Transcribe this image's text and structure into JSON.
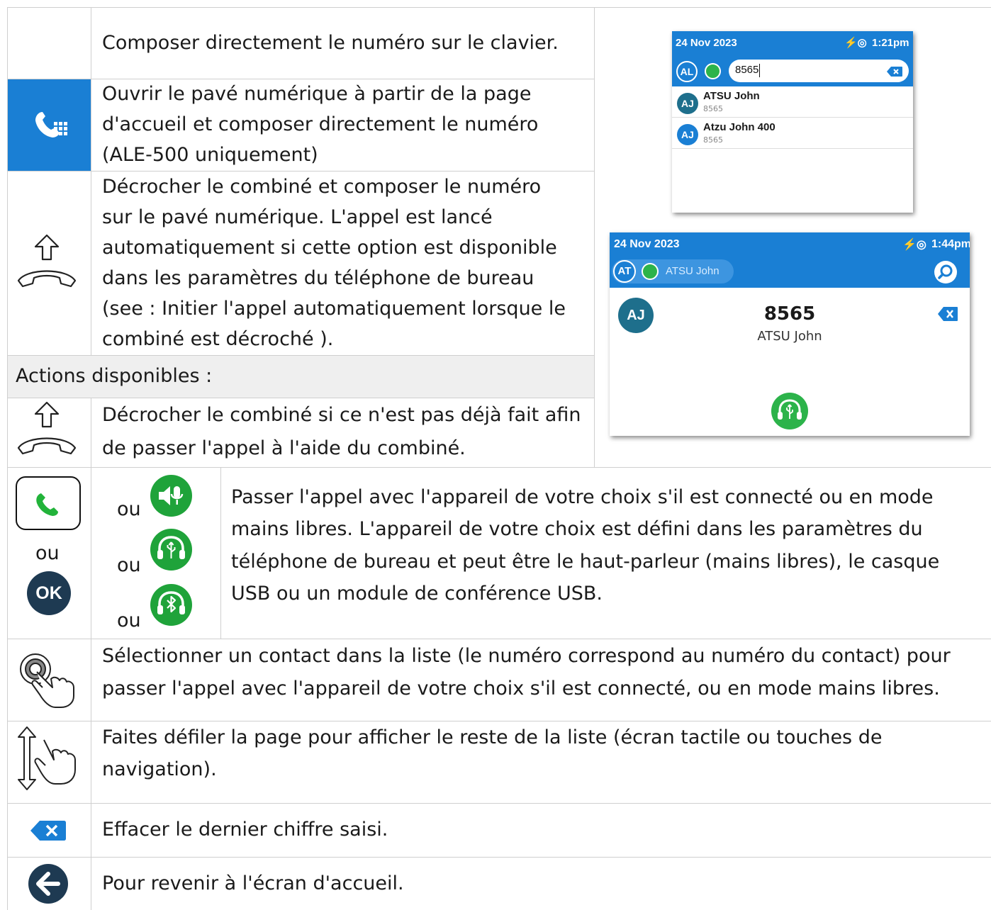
{
  "rows": {
    "dial_direct": "Composer directement le numéro sur le clavier.",
    "dialpad_lines": [
      "Ouvrir le pavé numérique à partir de la page",
      "d'accueil et composer directement le numéro",
      "(ALE-500 uniquement)"
    ],
    "handset_lines": [
      "Décrocher le combiné et composer le numéro",
      "sur le pavé numérique. L'appel est lancé",
      "automatiquement si cette option est disponible",
      "dans les paramètres du téléphone de bureau",
      "(see  : Initier l'appel automatiquement lorsque le",
      "combiné est décroché )."
    ],
    "actions_header": "Actions disponibles :",
    "offhook_lines": [
      "Décrocher le combiné si ce n'est pas déjà fait afin",
      "de passer l'appel à l'aide du combiné."
    ],
    "ou": "ou",
    "ok_label": "OK",
    "device_lines": [
      "Passer l'appel avec l'appareil de votre choix s'il est connecté ou en mode",
      "mains libres. L'appareil de votre choix est défini dans les paramètres du",
      "téléphone de bureau et peut être le haut-parleur (mains libres), le casque",
      "USB ou un module de conférence USB."
    ],
    "select_lines": [
      "Sélectionner un contact dans la liste (le numéro correspond au numéro du contact) pour",
      "passer l'appel avec l'appareil de votre choix s'il est connecté, ou en mode mains libres."
    ],
    "scroll_lines": [
      "Faites défiler la page pour afficher le reste de la liste (écran tactile ou touches de",
      "navigation)."
    ],
    "erase": "Effacer le dernier chiffre saisi.",
    "back": "Pour revenir à l'écran d'accueil."
  },
  "screen1": {
    "date": "24 Nov 2023",
    "time": "1:21pm",
    "badge": "AL",
    "search_value": "8565",
    "contacts": [
      {
        "initials": "AJ",
        "name": "ATSU John",
        "number": "8565"
      },
      {
        "initials": "AJ",
        "name": "Atzu John 400",
        "number": "8565"
      }
    ]
  },
  "screen2": {
    "date": "24 Nov 2023",
    "time": "1:44pm",
    "badge": "AT",
    "header_name": "ATSU John",
    "avatar": "AJ",
    "number": "8565",
    "name": "ATSU John"
  },
  "colors": {
    "blue": "#1a7fd4",
    "green": "#2cb34a",
    "grid": "#cfcfcf",
    "avatar": "#1e6f8c"
  }
}
